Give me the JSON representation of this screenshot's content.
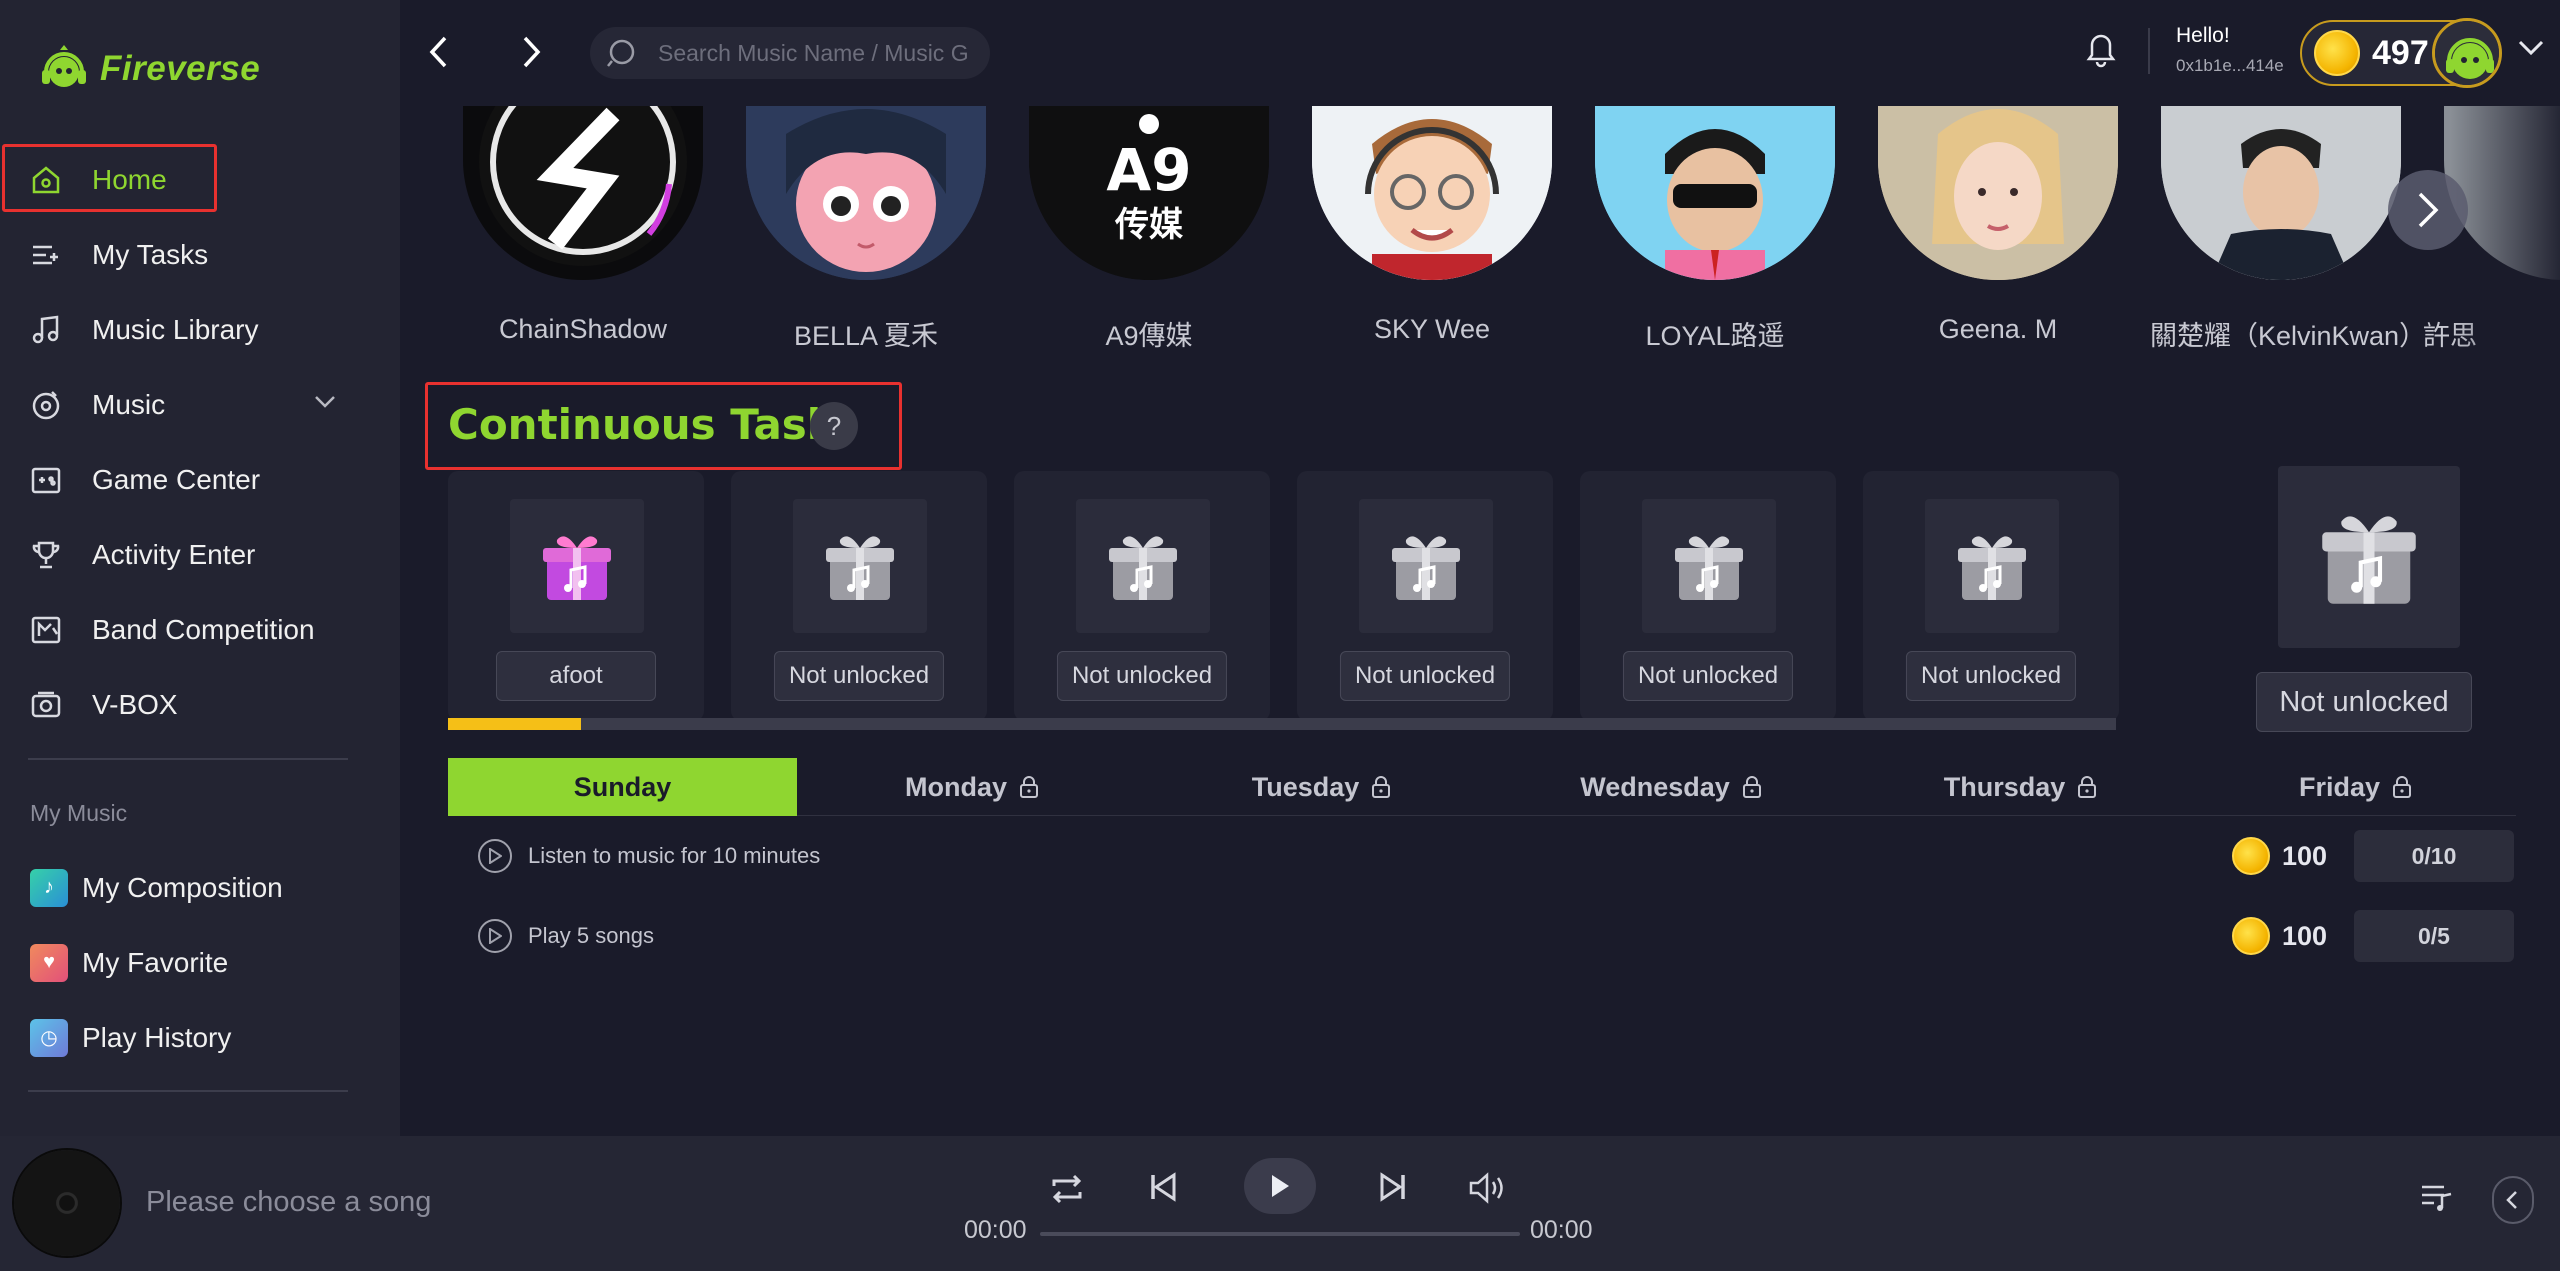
{
  "app": {
    "name": "Fireverse"
  },
  "sidebar": {
    "items": [
      {
        "label": "Home",
        "icon": "home-icon",
        "active": true
      },
      {
        "label": "My Tasks",
        "icon": "tasks-icon"
      },
      {
        "label": "Music Library",
        "icon": "music-note-icon"
      },
      {
        "label": "Music",
        "icon": "disc-icon",
        "expandable": true
      },
      {
        "label": "Game Center",
        "icon": "game-icon"
      },
      {
        "label": "Activity Enter",
        "icon": "trophy-icon"
      },
      {
        "label": "Band Competition",
        "icon": "band-icon"
      },
      {
        "label": "V-BOX",
        "icon": "vbox-icon"
      }
    ],
    "my_music_label": "My Music",
    "my_music": [
      {
        "label": "My Composition",
        "icon": "composition-icon",
        "color": "#2fc4b0"
      },
      {
        "label": "My Favorite",
        "icon": "heart-icon",
        "color": "#e8607a"
      },
      {
        "label": "Play History",
        "icon": "history-icon",
        "color": "#4aa8d8"
      }
    ]
  },
  "header": {
    "search_placeholder": "Search Music Name / Music Ge",
    "greeting": "Hello!",
    "wallet": "0x1b1e...414e",
    "coins": "497"
  },
  "artists": [
    {
      "name": "ChainShadow"
    },
    {
      "name": "BELLA 夏禾"
    },
    {
      "name": "A9傳媒"
    },
    {
      "name": "SKY Wee"
    },
    {
      "name": "LOYAL路遥"
    },
    {
      "name": "Geena. M"
    },
    {
      "name": "關楚耀（KelvinKwan）"
    },
    {
      "name": "許思"
    }
  ],
  "continuous_task": {
    "title": "Continuous Task",
    "help": "?",
    "cards": [
      {
        "label": "afoot",
        "unlocked": true
      },
      {
        "label": "Not unlocked"
      },
      {
        "label": "Not unlocked"
      },
      {
        "label": "Not unlocked"
      },
      {
        "label": "Not unlocked"
      },
      {
        "label": "Not unlocked"
      }
    ],
    "final_card": {
      "label": "Not unlocked"
    },
    "progress": 0.08,
    "days": [
      {
        "label": "Sunday",
        "active": true,
        "locked": false
      },
      {
        "label": "Monday",
        "locked": true
      },
      {
        "label": "Tuesday",
        "locked": true
      },
      {
        "label": "Wednesday",
        "locked": true
      },
      {
        "label": "Thursday",
        "locked": true
      },
      {
        "label": "Friday",
        "locked": true
      }
    ],
    "tasks": [
      {
        "text": "Listen to music for 10 minutes",
        "reward": "100",
        "progress": "0/10"
      },
      {
        "text": "Play 5 songs",
        "reward": "100",
        "progress": "0/5"
      }
    ]
  },
  "player": {
    "song": "Please choose a song",
    "time_current": "00:00",
    "time_total": "00:00"
  },
  "colors": {
    "accent": "#8fd630",
    "bg": "#1a1b2a",
    "sidebar": "#232432",
    "coin": "#f4b400",
    "highlight": "#e8312f"
  }
}
